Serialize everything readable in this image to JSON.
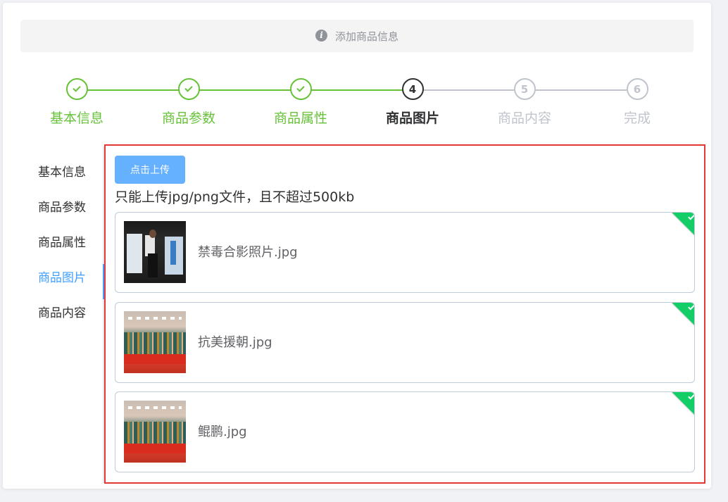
{
  "alert": {
    "text": "添加商品信息"
  },
  "steps": [
    {
      "index": "1",
      "label": "基本信息",
      "status": "success"
    },
    {
      "index": "2",
      "label": "商品参数",
      "status": "success"
    },
    {
      "index": "3",
      "label": "商品属性",
      "status": "success"
    },
    {
      "index": "4",
      "label": "商品图片",
      "status": "process"
    },
    {
      "index": "5",
      "label": "商品内容",
      "status": "wait"
    },
    {
      "index": "6",
      "label": "完成",
      "status": "wait"
    }
  ],
  "tabs": [
    {
      "label": "基本信息"
    },
    {
      "label": "商品参数"
    },
    {
      "label": "商品属性"
    },
    {
      "label": "商品图片",
      "active": true
    },
    {
      "label": "商品内容"
    }
  ],
  "upload": {
    "button_label": "点击上传",
    "tip": "只能上传jpg/png文件，且不超过500kb",
    "files": [
      {
        "name": "禁毒合影照片.jpg",
        "status": "success"
      },
      {
        "name": "抗美援朝.jpg",
        "status": "success"
      },
      {
        "name": "鲲鹏.jpg",
        "status": "success"
      }
    ]
  },
  "colors": {
    "success": "#67c23a",
    "active_tab": "#409eff",
    "upload_button": "#66b1ff",
    "upload_status": "#13ce66",
    "highlight_border": "#e53935"
  }
}
